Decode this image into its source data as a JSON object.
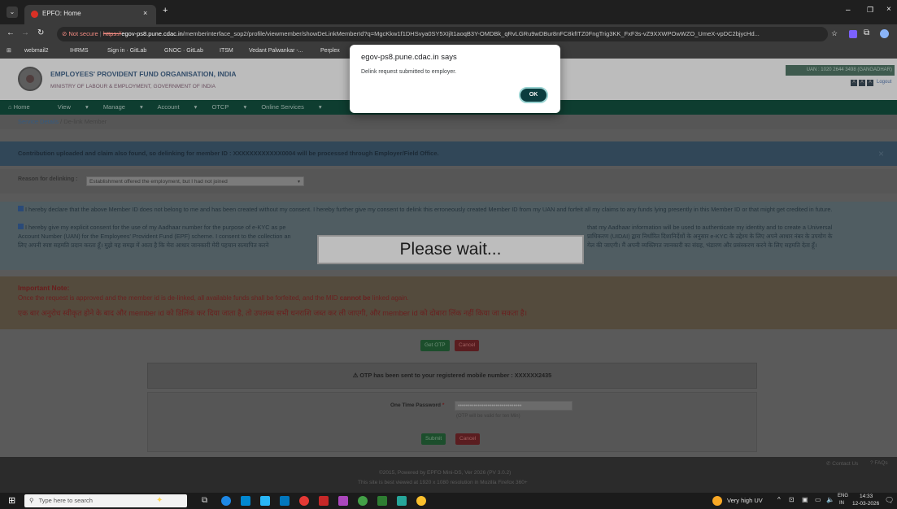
{
  "browser": {
    "tab_title": "EPFO: Home",
    "not_secure": "Not secure",
    "url_https": "https://",
    "url_host": "egov-ps8.pune.cdac.in",
    "url_path": "/memberinterface_sop2/profile/viewmember/showDeLinkMemberId?q=MgcKkw1f1DHSvya0SY5XIjlt1aoqB3Y-OMDBk_qRvLGRu9wDBur8nFC8kfITZ0FngTrig3KK_FxF3s-vZ9XXWPOwWZO_UmeX-vpDC2bjycHd...",
    "bookmarks": [
      "webmail2",
      "IHRMS",
      "Sign in · GitLab",
      "GNOC · GitLab",
      "ITSM",
      "Vedant Palwankar -...",
      "Perplex"
    ]
  },
  "header": {
    "org_name": "EMPLOYEES' PROVIDENT FUND ORGANISATION, INDIA",
    "ministry": "MINISTRY OF LABOUR & EMPLOYMENT, GOVERNMENT OF INDIA",
    "uan": "UAN : 1020 2644 3498 (GANGADHAR)",
    "lang": [
      "A",
      "A",
      "A"
    ],
    "logout": "Logout"
  },
  "nav": {
    "home": "Home",
    "view": "View",
    "manage": "Manage",
    "account": "Account",
    "otcp": "OTCP",
    "online": "Online Services"
  },
  "breadcrumb": {
    "parent": "Service Details",
    "current": "De-link Member"
  },
  "alert": {
    "text": "Contribution uploaded and claim also found, so delinking for member ID : XXXXXXXXXXXX0004 will be processed through Employer/Field Office.",
    "close": "×"
  },
  "reason": {
    "label": "Reason for delinking :",
    "selected": "Establishment offered the employment, but I had not joined"
  },
  "consent": {
    "p1": "I hereby declare that the above Member ID does not belong to me and has been created without my consent. I hereby further give my consent to delink this erroneously created Member ID from my UAN and forfeit all my claims to any funds lying presently in this Member ID or that might get credited in future.",
    "p2_left": "I hereby give my explicit consent for the use of my Aadhaar number for the purpose of e-KYC as pe",
    "p2_right": "that my Aadhaar information will be used to authenticate my identity and to create a Universal",
    "p2_line2_left": "Account Number (UAN) for the Employees' Provident Fund (EPF) scheme. I consent to the collection an",
    "p2_line2_right": "प्राधिकरण (UIDAI) द्वारा निर्धारित दिशानिर्देशों के अनुसार e-KYC के उद्देश्य के लिए अपने आधार नंबर के उपयोग के",
    "p2_line3_left": "लिए अपनी स्पष्ट सहमति प्रदान करता हूँ। मुझे यह समझ में आता है कि मेरा आधार जानकारी मेरी पहचान सत्यापित करने",
    "p2_line3_right": "गेल की जाएगी। मैं अपनी व्यक्तिगत जानकारी का संग्रह, भंडारण और प्रसंस्करण करने के लिए सहमति देता हूँ।"
  },
  "important": {
    "heading": "Important Note:",
    "line_en_prefix": "Once the request is approved and the member id is de-linked, all available funds shall be forfeited, and the MID ",
    "line_en_bold": "cannot be",
    "line_en_suffix": " linked again.",
    "line_hi": "एक बार अनुरोध स्वीकृत होने के बाद और member id को डिलिंक कर दिया जाता है, तो उपलब्ध सभी धनराशि जब्त कर ली जाएगी, और member id को दोबारा लिंक नहीं किया जा सकता है।"
  },
  "buttons": {
    "get_otp": "Get OTP",
    "cancel": "Cancel",
    "submit": "Submit",
    "cancel2": "Cancel"
  },
  "otp": {
    "sent_msg": "⚠ OTP has been sent to your registered mobile number : XXXXXX2435",
    "label": "One Time Password",
    "required": "*",
    "value": "••••••••••••••••••••••••••••••••",
    "hint": "(OTP will be valid for ten Min)"
  },
  "footer": {
    "copyright": "©2015, Powered by EPFO Mini-DS, Ver 2026 (PV 3.0.2)",
    "best_viewed": "This site is best viewed at 1920 x 1080 resolution in Mozilla Firefox 360+",
    "contact": "Contact Us",
    "faqs": "FAQs"
  },
  "overlay": {
    "please_wait": "Please wait..."
  },
  "dialog": {
    "title": "egov-ps8.pune.cdac.in says",
    "message": "Delink request submitted to employer.",
    "ok": "OK"
  },
  "taskbar": {
    "search_placeholder": "Type here to search",
    "weather": "Very high UV",
    "lang1": "ENG",
    "lang2": "IN",
    "time": "14:33",
    "date": "12-03-2026"
  },
  "colors": {
    "epfo_green": "#0e3d30",
    "dialog_ok": "#0b3d3f",
    "red_button": "#5a1d20"
  }
}
